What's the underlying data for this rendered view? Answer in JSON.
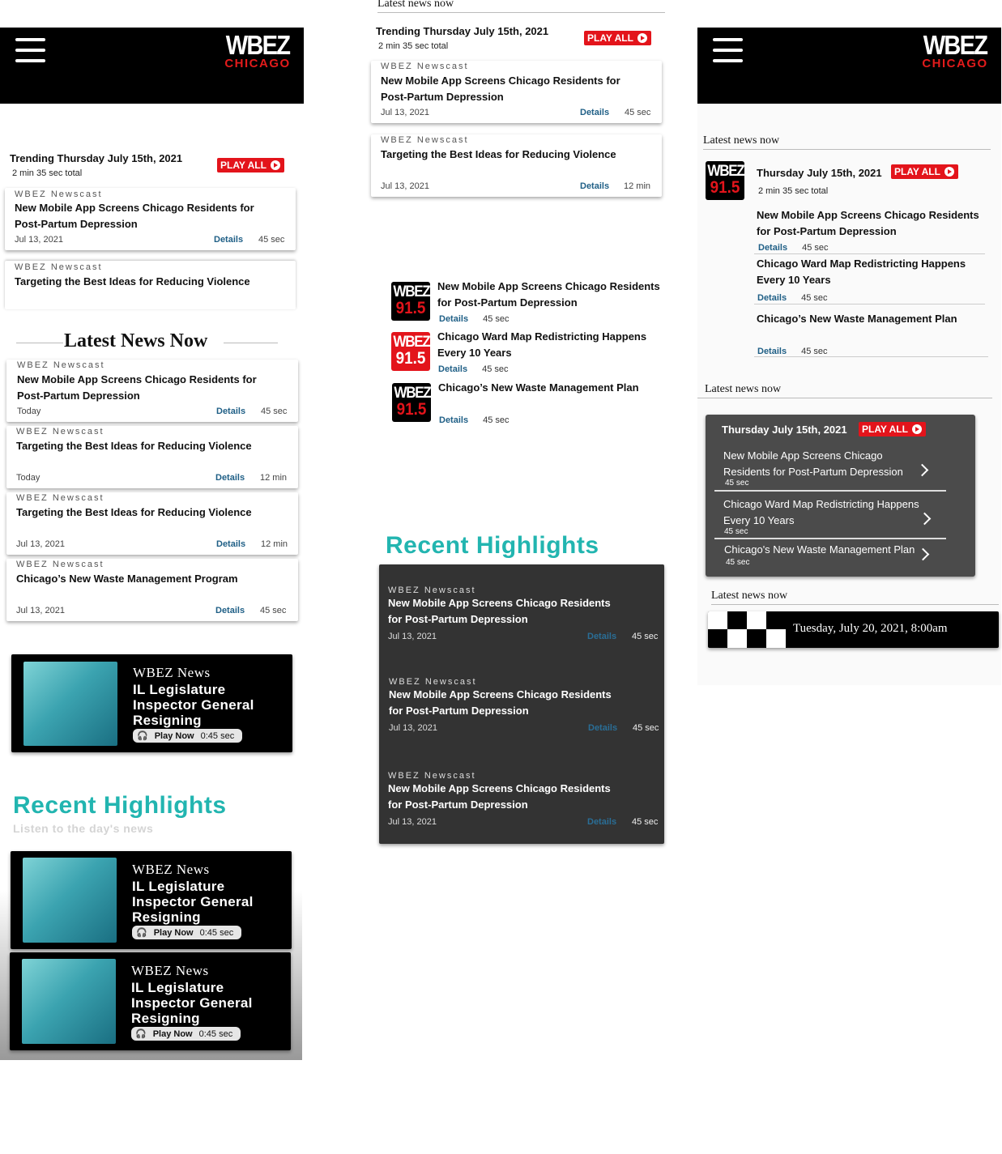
{
  "brand": {
    "logo_top": "WBEZ",
    "logo_bottom": "CHICAGO",
    "tile_top": "WBEZ",
    "tile_bottom": "91.5"
  },
  "play_all": "PLAY ALL",
  "trending": {
    "title": "Trending Thursday July 15th, 2021",
    "total": "2 min 35 sec total"
  },
  "source": "WBEZ Newscast",
  "details": "Details",
  "story1": "New Mobile App Screens Chicago Residents for Post-Partum Depression",
  "story2": "Targeting the Best Ideas for Reducing Violence",
  "story3": "Chicago Ward Map Redistricting Happens Every 10 Years",
  "story4": "Chicago’s New Waste Management Plan",
  "story5": "Chicago’s New Waste Management Program",
  "story4_alt": "Chicago's New Waste Management Plan",
  "date_jul13": "Jul 13, 2021",
  "today": "Today",
  "dur45": "45 sec",
  "dur12": "12 min",
  "latest_news_now_big": "Latest News Now",
  "latest_news_now": "Latest news now",
  "promo": {
    "label": "WBEZ News",
    "headline": "IL Legislature Inspector General Resigning",
    "play": "Play Now",
    "time": "0:45 sec"
  },
  "recent": {
    "title": "Recent Highlights",
    "subtitle": "Listen to the day's news"
  },
  "thursday": "Thursday July 15th, 2021",
  "thursday2": "Thursday July 15th, 2021",
  "darkbox": {
    "s1": "New Mobile App Screens Chicago Residents for Post-Partum Depression",
    "s2": "Chicago Ward Map Redistricting Happens Every 10 Years",
    "s3": "Chicago's New Waste Management Plan"
  },
  "date_banner": "Tuesday, July 20, 2021, 8:00am",
  "colors": {
    "red": "#e3141b",
    "teal": "#22b5b0",
    "link": "#1f5f86"
  }
}
